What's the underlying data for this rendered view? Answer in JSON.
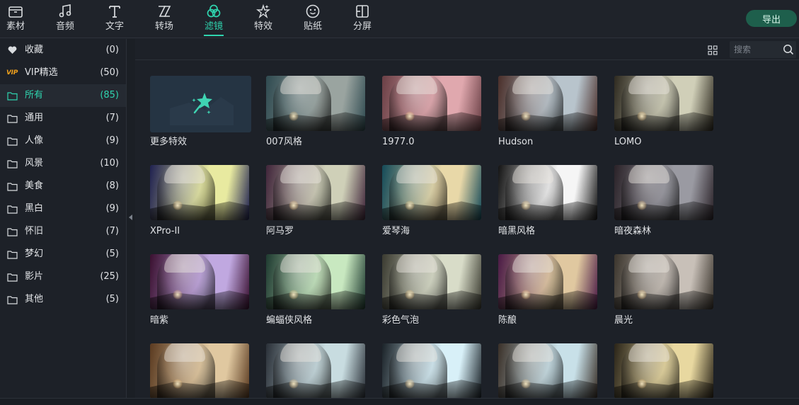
{
  "toolbar": {
    "tabs": [
      {
        "label": "素材",
        "icon": "folder-icon"
      },
      {
        "label": "音频",
        "icon": "music-note-icon"
      },
      {
        "label": "文字",
        "icon": "text-icon"
      },
      {
        "label": "转场",
        "icon": "transition-icon"
      },
      {
        "label": "滤镜",
        "icon": "filter-icon",
        "active": true
      },
      {
        "label": "特效",
        "icon": "effects-star-icon"
      },
      {
        "label": "贴纸",
        "icon": "sticker-icon"
      },
      {
        "label": "分屏",
        "icon": "split-screen-icon"
      }
    ],
    "export_label": "导出"
  },
  "sidebar": {
    "items": [
      {
        "label": "收藏",
        "count": "(0)",
        "icon": "heart-icon"
      },
      {
        "label": "VIP精选",
        "count": "(50)",
        "icon": "vip-badge-icon",
        "badge": "VIP"
      },
      {
        "label": "所有",
        "count": "(85)",
        "icon": "folder-icon",
        "active": true
      },
      {
        "label": "通用",
        "count": "(7)",
        "icon": "folder-icon"
      },
      {
        "label": "人像",
        "count": "(9)",
        "icon": "folder-icon"
      },
      {
        "label": "风景",
        "count": "(10)",
        "icon": "folder-icon"
      },
      {
        "label": "美食",
        "count": "(8)",
        "icon": "folder-icon"
      },
      {
        "label": "黑白",
        "count": "(9)",
        "icon": "folder-icon"
      },
      {
        "label": "怀旧",
        "count": "(7)",
        "icon": "folder-icon"
      },
      {
        "label": "梦幻",
        "count": "(5)",
        "icon": "folder-icon"
      },
      {
        "label": "影片",
        "count": "(25)",
        "icon": "folder-icon"
      },
      {
        "label": "其他",
        "count": "(5)",
        "icon": "folder-icon"
      }
    ]
  },
  "search": {
    "placeholder": "搜索"
  },
  "grid": {
    "more_card": {
      "label": "更多特效",
      "icon": "magic-wand-star-icon"
    },
    "filters": [
      {
        "label": "007风格",
        "tint": [
          "#9aa4a0",
          "#2f4a50"
        ]
      },
      {
        "label": "1977.0",
        "tint": [
          "#e0a8ae",
          "#6a3f45"
        ]
      },
      {
        "label": "Hudson",
        "tint": [
          "#b8c4cc",
          "#4a2f2a"
        ]
      },
      {
        "label": "LOMO",
        "tint": [
          "#d0cfb8",
          "#2e2a20"
        ]
      },
      {
        "label": "XPro-II",
        "tint": [
          "#e8eaa0",
          "#1f2150"
        ]
      },
      {
        "label": "阿马罗",
        "tint": [
          "#cfd0b8",
          "#40253a"
        ]
      },
      {
        "label": "爱琴海",
        "tint": [
          "#e8d8a8",
          "#144a58"
        ]
      },
      {
        "label": "暗黑风格",
        "tint": [
          "#f5f5f5",
          "#141414"
        ]
      },
      {
        "label": "暗夜森林",
        "tint": [
          "#9a9aa2",
          "#2a2228"
        ]
      },
      {
        "label": "暗紫",
        "tint": [
          "#c0a8e0",
          "#3a1030"
        ]
      },
      {
        "label": "蝙蝠侠风格",
        "tint": [
          "#c8e8c0",
          "#1e3a30"
        ]
      },
      {
        "label": "彩色气泡",
        "tint": [
          "#d8dcc8",
          "#3a3a30"
        ]
      },
      {
        "label": "陈酿",
        "tint": [
          "#e0c8a0",
          "#4a1a45"
        ]
      },
      {
        "label": "晨光",
        "tint": [
          "#c8c0b8",
          "#3a342c"
        ]
      },
      {
        "label": "",
        "tint": [
          "#e0c8a0",
          "#5a3a20"
        ]
      },
      {
        "label": "",
        "tint": [
          "#c8dce0",
          "#2a3038"
        ]
      },
      {
        "label": "",
        "tint": [
          "#d8f0f8",
          "#1a2228"
        ]
      },
      {
        "label": "",
        "tint": [
          "#c8e0e8",
          "#3a3028"
        ]
      },
      {
        "label": "",
        "tint": [
          "#e8d8a0",
          "#2a2418"
        ]
      }
    ]
  }
}
